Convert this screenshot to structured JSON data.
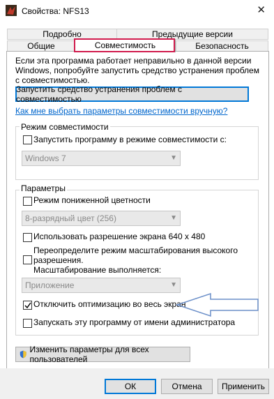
{
  "window": {
    "title": "Свойства: NFS13",
    "close_glyph": "✕",
    "icon": "nfs-app-icon"
  },
  "tabs": {
    "row1": [
      {
        "label": "Подробно"
      },
      {
        "label": "Предыдущие версии"
      }
    ],
    "row2": [
      {
        "label": "Общие"
      },
      {
        "label": "Совместимость",
        "active": true
      },
      {
        "label": "Безопасность"
      }
    ]
  },
  "compat": {
    "description": "Если эта программа работает неправильно в данной версии Windows, попробуйте запустить средство устранения проблем с совместимостью.",
    "troubleshoot_button": "Запустить средство устранения проблем с совместимостью",
    "manual_link": "Как мне выбрать параметры совместимости вручную?",
    "mode_group": {
      "legend": "Режим совместимости",
      "checkbox_label": "Запустить программу в режиме совместимости с:",
      "checked": false,
      "os_select": "Windows 7"
    },
    "settings_group": {
      "legend": "Параметры",
      "reduced_color_label": "Режим пониженной цветности",
      "reduced_color_checked": false,
      "color_select": "8-разрядный цвет (256)",
      "res_640_label": "Использовать разрешение экрана 640 x 480",
      "res_640_checked": false,
      "dpi_label_1": "Переопределите режим масштабирования высокого",
      "dpi_label_2": "разрешения.",
      "dpi_label_3": "Масштабирование выполняется:",
      "dpi_checked": false,
      "dpi_select": "Приложение",
      "fullscreen_opt_label": "Отключить оптимизацию во весь экран",
      "fullscreen_opt_checked": true,
      "admin_label": "Запускать эту программу от имени администратора",
      "admin_checked": false
    },
    "all_users_button": "Изменить параметры для всех пользователей",
    "highlight_color": "#d11b4d",
    "arrow_color": "#6b8fc9"
  },
  "footer": {
    "ok": "ОК",
    "cancel": "Отмена",
    "apply": "Применить"
  }
}
